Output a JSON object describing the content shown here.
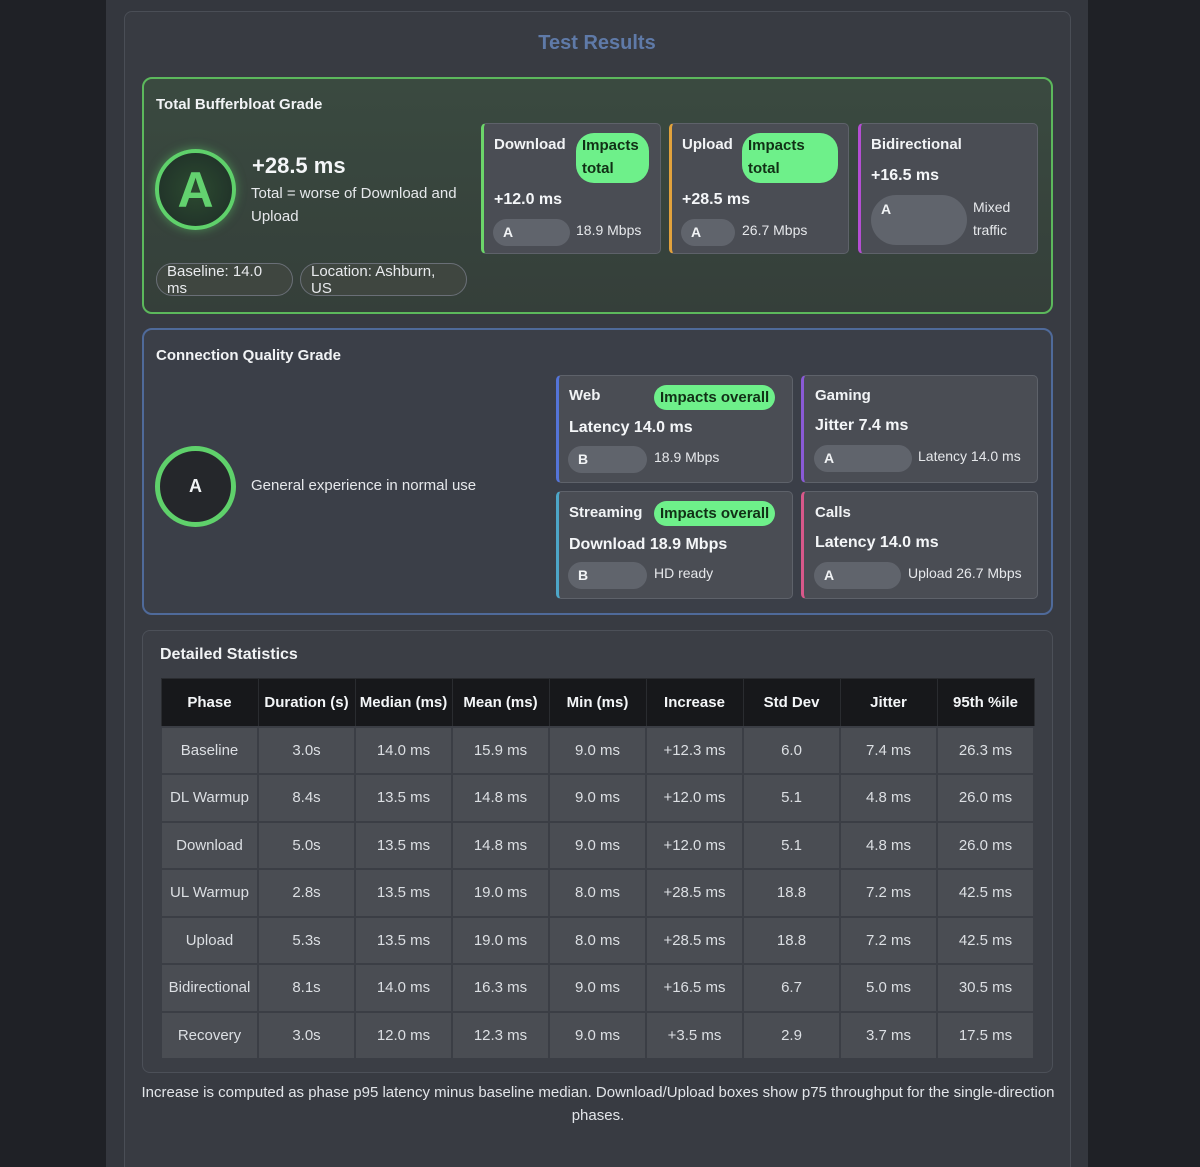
{
  "title": "Test Results",
  "bufferbloat": {
    "heading": "Total Bufferbloat Grade",
    "grade": "A",
    "value": "+28.5 ms",
    "description": "Total = worse of Download and Upload",
    "baseline": "Baseline: 14.0 ms",
    "location": "Location: Ashburn, US",
    "download": {
      "title": "Download",
      "badge": "Impacts total",
      "value": "+12.0 ms",
      "grade": "A",
      "note": "18.9 Mbps"
    },
    "upload": {
      "title": "Upload",
      "badge": "Impacts total",
      "value": "+28.5 ms",
      "grade": "A",
      "note": "26.7 Mbps"
    },
    "bidirectional": {
      "title": "Bidirectional",
      "value": "+16.5 ms",
      "grade": "A",
      "note": "Mixed traffic"
    }
  },
  "connection_quality": {
    "heading": "Connection Quality Grade",
    "grade": "A",
    "description": "General experience in normal use",
    "web": {
      "title": "Web",
      "badge": "Impacts overall",
      "value": "Latency 14.0 ms",
      "grade": "B",
      "note": "18.9 Mbps"
    },
    "gaming": {
      "title": "Gaming",
      "value": "Jitter 7.4 ms",
      "grade": "A",
      "note": "Latency 14.0 ms"
    },
    "streaming": {
      "title": "Streaming",
      "badge": "Impacts overall",
      "value": "Download 18.9 Mbps",
      "grade": "B",
      "note": "HD ready"
    },
    "calls": {
      "title": "Calls",
      "value": "Latency 14.0 ms",
      "grade": "A",
      "note": "Upload 26.7 Mbps"
    }
  },
  "stats": {
    "heading": "Detailed Statistics",
    "columns": [
      "Phase",
      "Duration (s)",
      "Median (ms)",
      "Mean (ms)",
      "Min (ms)",
      "Increase",
      "Std Dev",
      "Jitter",
      "95th %ile"
    ],
    "rows": [
      [
        "Baseline",
        "3.0s",
        "14.0 ms",
        "15.9 ms",
        "9.0 ms",
        "+12.3 ms",
        "6.0",
        "7.4 ms",
        "26.3 ms"
      ],
      [
        "DL Warmup",
        "8.4s",
        "13.5 ms",
        "14.8 ms",
        "9.0 ms",
        "+12.0 ms",
        "5.1",
        "4.8 ms",
        "26.0 ms"
      ],
      [
        "Download",
        "5.0s",
        "13.5 ms",
        "14.8 ms",
        "9.0 ms",
        "+12.0 ms",
        "5.1",
        "4.8 ms",
        "26.0 ms"
      ],
      [
        "UL Warmup",
        "2.8s",
        "13.5 ms",
        "19.0 ms",
        "8.0 ms",
        "+28.5 ms",
        "18.8",
        "7.2 ms",
        "42.5 ms"
      ],
      [
        "Upload",
        "5.3s",
        "13.5 ms",
        "19.0 ms",
        "8.0 ms",
        "+28.5 ms",
        "18.8",
        "7.2 ms",
        "42.5 ms"
      ],
      [
        "Bidirectional",
        "8.1s",
        "14.0 ms",
        "16.3 ms",
        "9.0 ms",
        "+16.5 ms",
        "6.7",
        "5.0 ms",
        "30.5 ms"
      ],
      [
        "Recovery",
        "3.0s",
        "12.0 ms",
        "12.3 ms",
        "9.0 ms",
        "+3.5 ms",
        "2.9",
        "3.7 ms",
        "17.5 ms"
      ]
    ]
  },
  "footnote": "Increase is computed as phase p95 latency minus baseline median. Download/Upload boxes show p75 throughput for the single-direction phases."
}
